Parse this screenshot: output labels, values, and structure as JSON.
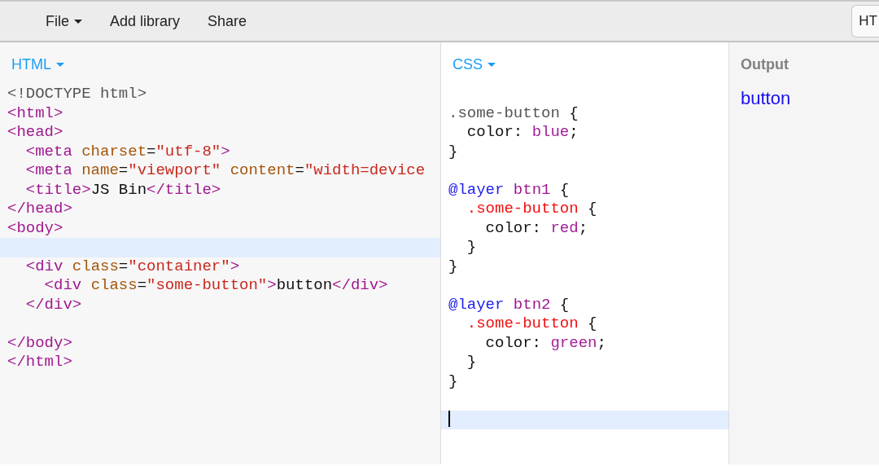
{
  "menu": [
    {
      "label": "File",
      "dropdown": true
    },
    {
      "label": "Add library",
      "dropdown": false
    },
    {
      "label": "Share",
      "dropdown": false
    }
  ],
  "panel_tabs": [
    {
      "label": "HT",
      "selected": true
    }
  ],
  "html_panel": {
    "label": "HTML",
    "focused": false,
    "lines": [
      {
        "kind": "code",
        "tokens": [
          {
            "kind": "meta",
            "text": "<!DOCTYPE html>"
          }
        ]
      },
      {
        "kind": "code",
        "tokens": [
          {
            "kind": "tag",
            "text": "<html>"
          }
        ]
      },
      {
        "kind": "code",
        "tokens": [
          {
            "kind": "tag",
            "text": "<head>"
          }
        ]
      },
      {
        "kind": "code",
        "tokens": [
          {
            "kind": "tag",
            "text": "  <meta "
          },
          {
            "kind": "attribute",
            "text": "charset"
          },
          {
            "kind": "plain",
            "text": "="
          },
          {
            "kind": "string",
            "text": "\"utf-8\""
          },
          {
            "kind": "tag",
            "text": ">"
          }
        ]
      },
      {
        "kind": "code",
        "tokens": [
          {
            "kind": "tag",
            "text": "  <meta "
          },
          {
            "kind": "attribute",
            "text": "name"
          },
          {
            "kind": "plain",
            "text": "="
          },
          {
            "kind": "string",
            "text": "\"viewport\""
          },
          {
            "kind": "attribute",
            "text": " content"
          },
          {
            "kind": "plain",
            "text": "="
          },
          {
            "kind": "string",
            "text": "\"width=device"
          }
        ]
      },
      {
        "kind": "code",
        "tokens": [
          {
            "kind": "tag",
            "text": "  <title>"
          },
          {
            "kind": "plain",
            "text": "JS Bin"
          },
          {
            "kind": "tag",
            "text": "</title>"
          }
        ]
      },
      {
        "kind": "code",
        "tokens": [
          {
            "kind": "tag",
            "text": "</head>"
          }
        ]
      },
      {
        "kind": "code",
        "tokens": [
          {
            "kind": "tag",
            "text": "<body>"
          }
        ]
      },
      {
        "kind": "current"
      },
      {
        "kind": "code",
        "tokens": [
          {
            "kind": "tag",
            "text": "  <div "
          },
          {
            "kind": "attribute",
            "text": "class"
          },
          {
            "kind": "plain",
            "text": "="
          },
          {
            "kind": "string",
            "text": "\"container\""
          },
          {
            "kind": "tag",
            "text": ">"
          }
        ]
      },
      {
        "kind": "code",
        "tokens": [
          {
            "kind": "tag",
            "text": "    <div "
          },
          {
            "kind": "attribute",
            "text": "class"
          },
          {
            "kind": "plain",
            "text": "="
          },
          {
            "kind": "string",
            "text": "\"some-button\""
          },
          {
            "kind": "tag",
            "text": ">"
          },
          {
            "kind": "plain",
            "text": "button"
          },
          {
            "kind": "tag",
            "text": "</div>"
          }
        ]
      },
      {
        "kind": "code",
        "tokens": [
          {
            "kind": "tag",
            "text": "  </div>"
          }
        ]
      },
      {
        "kind": "blank"
      },
      {
        "kind": "code",
        "tokens": [
          {
            "kind": "tag",
            "text": "</body>"
          }
        ]
      },
      {
        "kind": "code",
        "tokens": [
          {
            "kind": "tag",
            "text": "</html>"
          }
        ]
      }
    ]
  },
  "css_panel": {
    "label": "CSS",
    "focused": true,
    "lines": [
      {
        "kind": "blank"
      },
      {
        "kind": "code",
        "tokens": [
          {
            "kind": "meta",
            "text": ".some-button"
          },
          {
            "kind": "plain",
            "text": " {"
          }
        ]
      },
      {
        "kind": "code",
        "tokens": [
          {
            "kind": "plain",
            "text": "  color: "
          },
          {
            "kind": "value",
            "text": "blue"
          },
          {
            "kind": "plain",
            "text": ";"
          }
        ]
      },
      {
        "kind": "code",
        "tokens": [
          {
            "kind": "plain",
            "text": "}"
          }
        ]
      },
      {
        "kind": "blank"
      },
      {
        "kind": "code",
        "tokens": [
          {
            "kind": "keyword",
            "text": "@layer"
          },
          {
            "kind": "tag",
            "text": " btn1"
          },
          {
            "kind": "plain",
            "text": " {"
          }
        ]
      },
      {
        "kind": "code",
        "tokens": [
          {
            "kind": "selector",
            "text": "  .some-button"
          },
          {
            "kind": "plain",
            "text": " {"
          }
        ]
      },
      {
        "kind": "code",
        "tokens": [
          {
            "kind": "plain",
            "text": "    color: "
          },
          {
            "kind": "value",
            "text": "red"
          },
          {
            "kind": "plain",
            "text": ";"
          }
        ]
      },
      {
        "kind": "code",
        "tokens": [
          {
            "kind": "plain",
            "text": "  }"
          }
        ]
      },
      {
        "kind": "code",
        "tokens": [
          {
            "kind": "plain",
            "text": "}"
          }
        ]
      },
      {
        "kind": "blank"
      },
      {
        "kind": "code",
        "tokens": [
          {
            "kind": "keyword",
            "text": "@layer"
          },
          {
            "kind": "tag",
            "text": " btn2"
          },
          {
            "kind": "plain",
            "text": " {"
          }
        ]
      },
      {
        "kind": "code",
        "tokens": [
          {
            "kind": "selector",
            "text": "  .some-button"
          },
          {
            "kind": "plain",
            "text": " {"
          }
        ]
      },
      {
        "kind": "code",
        "tokens": [
          {
            "kind": "plain",
            "text": "    color: "
          },
          {
            "kind": "value",
            "text": "green"
          },
          {
            "kind": "plain",
            "text": ";"
          }
        ]
      },
      {
        "kind": "code",
        "tokens": [
          {
            "kind": "plain",
            "text": "  }"
          }
        ]
      },
      {
        "kind": "code",
        "tokens": [
          {
            "kind": "plain",
            "text": "}"
          }
        ]
      },
      {
        "kind": "blank"
      },
      {
        "kind": "current"
      }
    ]
  },
  "output_panel": {
    "label": "Output",
    "content": "button"
  }
}
